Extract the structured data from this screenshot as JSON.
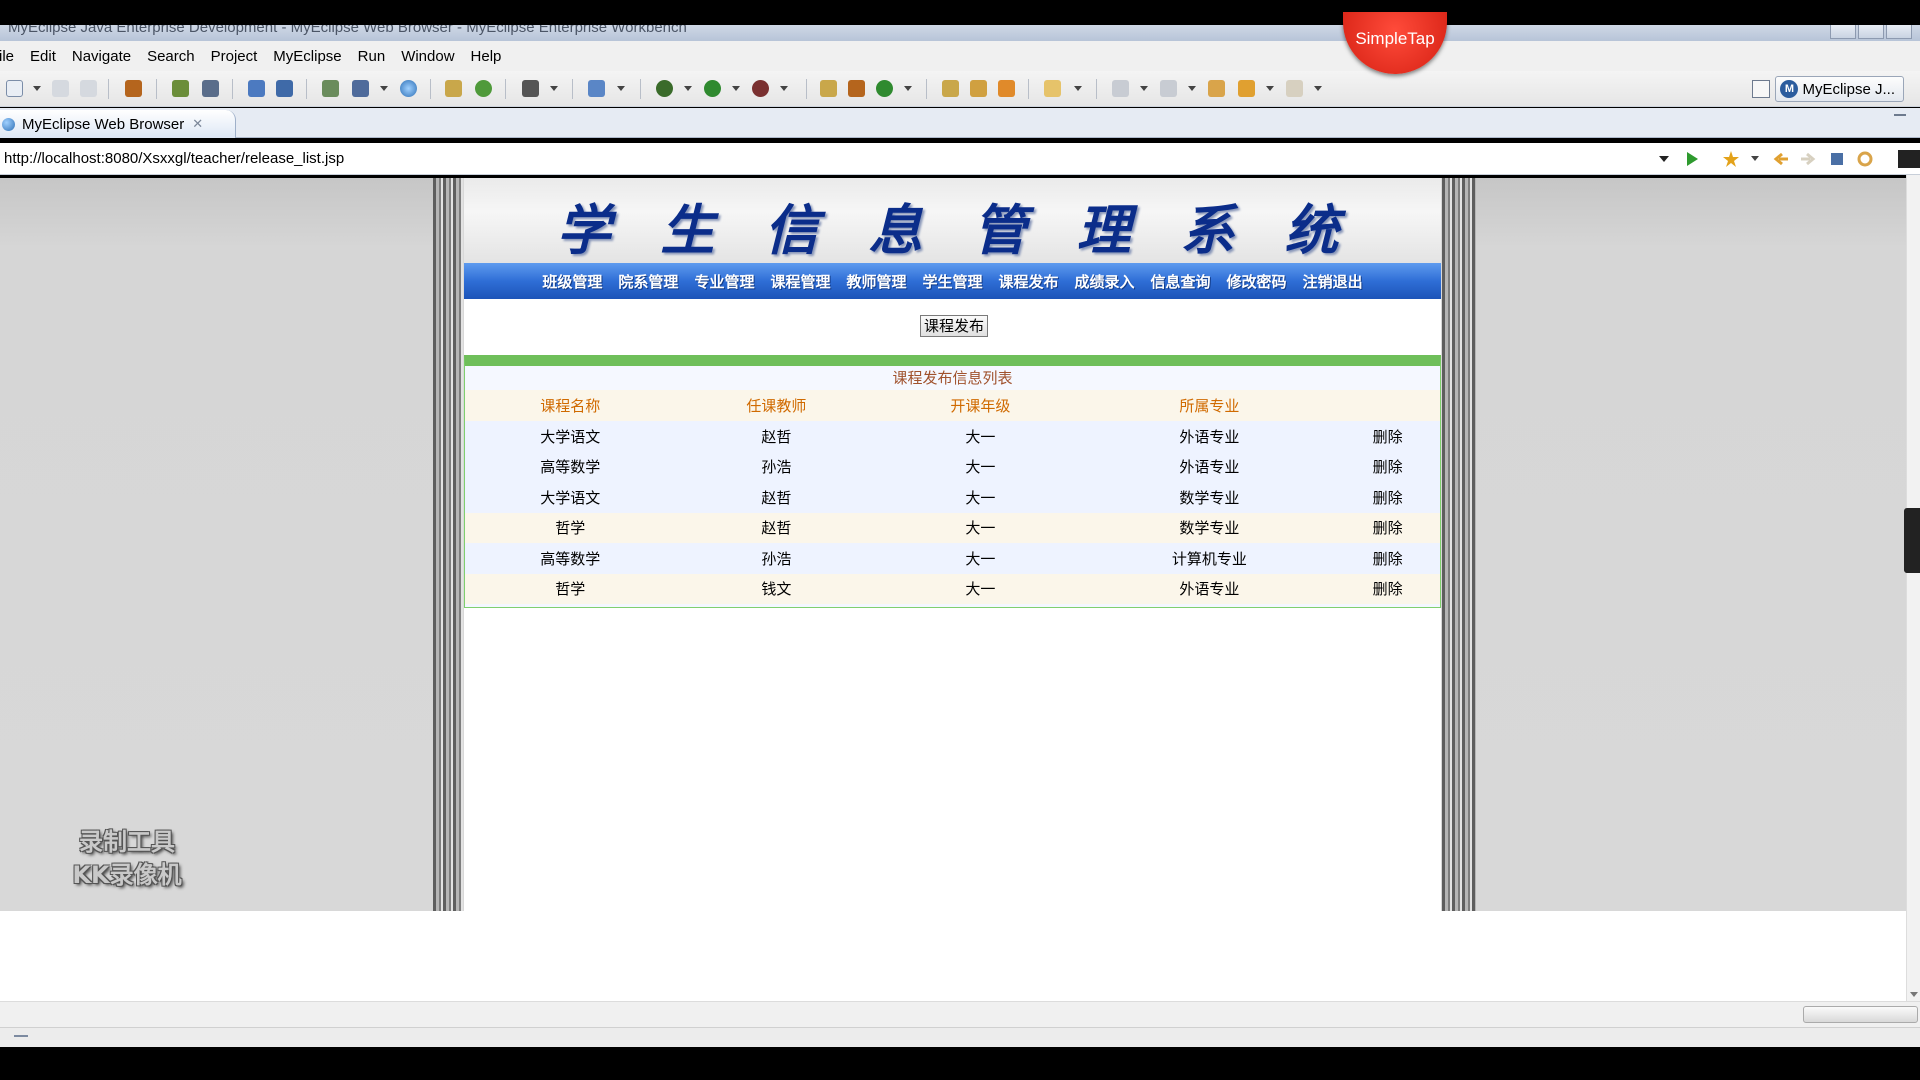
{
  "window": {
    "title": "MyEclipse Java Enterprise Development - MyEclipse Web Browser - MyEclipse Enterprise Workbench"
  },
  "overlay": {
    "simpletap_label": "SimpleTap"
  },
  "menubar": {
    "items": [
      "ile",
      "Edit",
      "Navigate",
      "Search",
      "Project",
      "MyEclipse",
      "Run",
      "Window",
      "Help"
    ]
  },
  "toolbar": {
    "perspective_label": "MyEclipse J...",
    "icons": [
      "new-icon",
      "save-icon",
      "save-all-icon",
      "package-icon",
      "debug-icon",
      "deploy-icon",
      "server-icon",
      "run-icon",
      "search-icon",
      "back-icon",
      "forward-icon"
    ]
  },
  "editor_tab": {
    "label": "MyEclipse Web Browser",
    "close_glyph": "✕"
  },
  "address_bar": {
    "url": "http://localhost:8080/Xsxxgl/teacher/release_list.jsp"
  },
  "page": {
    "title": "学生信息管理系统",
    "nav": [
      "班级管理",
      "院系管理",
      "专业管理",
      "课程管理",
      "教师管理",
      "学生管理",
      "课程发布",
      "成绩录入",
      "信息查询",
      "修改密码",
      "注销退出"
    ],
    "release_button": "课程发布",
    "list_title": "课程发布信息列表",
    "columns": [
      "课程名称",
      "任课教师",
      "开课年级",
      "所属专业",
      ""
    ],
    "rows": [
      {
        "course": "大学语文",
        "teacher": "赵哲",
        "grade": "大一",
        "major": "外语专业",
        "action": "删除"
      },
      {
        "course": "高等数学",
        "teacher": "孙浩",
        "grade": "大一",
        "major": "外语专业",
        "action": "删除"
      },
      {
        "course": "大学语文",
        "teacher": "赵哲",
        "grade": "大一",
        "major": "数学专业",
        "action": "删除"
      },
      {
        "course": "哲学",
        "teacher": "赵哲",
        "grade": "大一",
        "major": "数学专业",
        "action": "删除"
      },
      {
        "course": "高等数学",
        "teacher": "孙浩",
        "grade": "大一",
        "major": "计算机专业",
        "action": "删除"
      },
      {
        "course": "哲学",
        "teacher": "钱文",
        "grade": "大一",
        "major": "外语专业",
        "action": "删除"
      }
    ]
  },
  "watermark": {
    "line1": "录制工具",
    "line2": "KK录像机"
  },
  "colors": {
    "title_blue": "#0b2d8a",
    "nav_blue": "#2f6ed6",
    "green_border": "#6fbf5a",
    "header_orange": "#d06a00"
  }
}
